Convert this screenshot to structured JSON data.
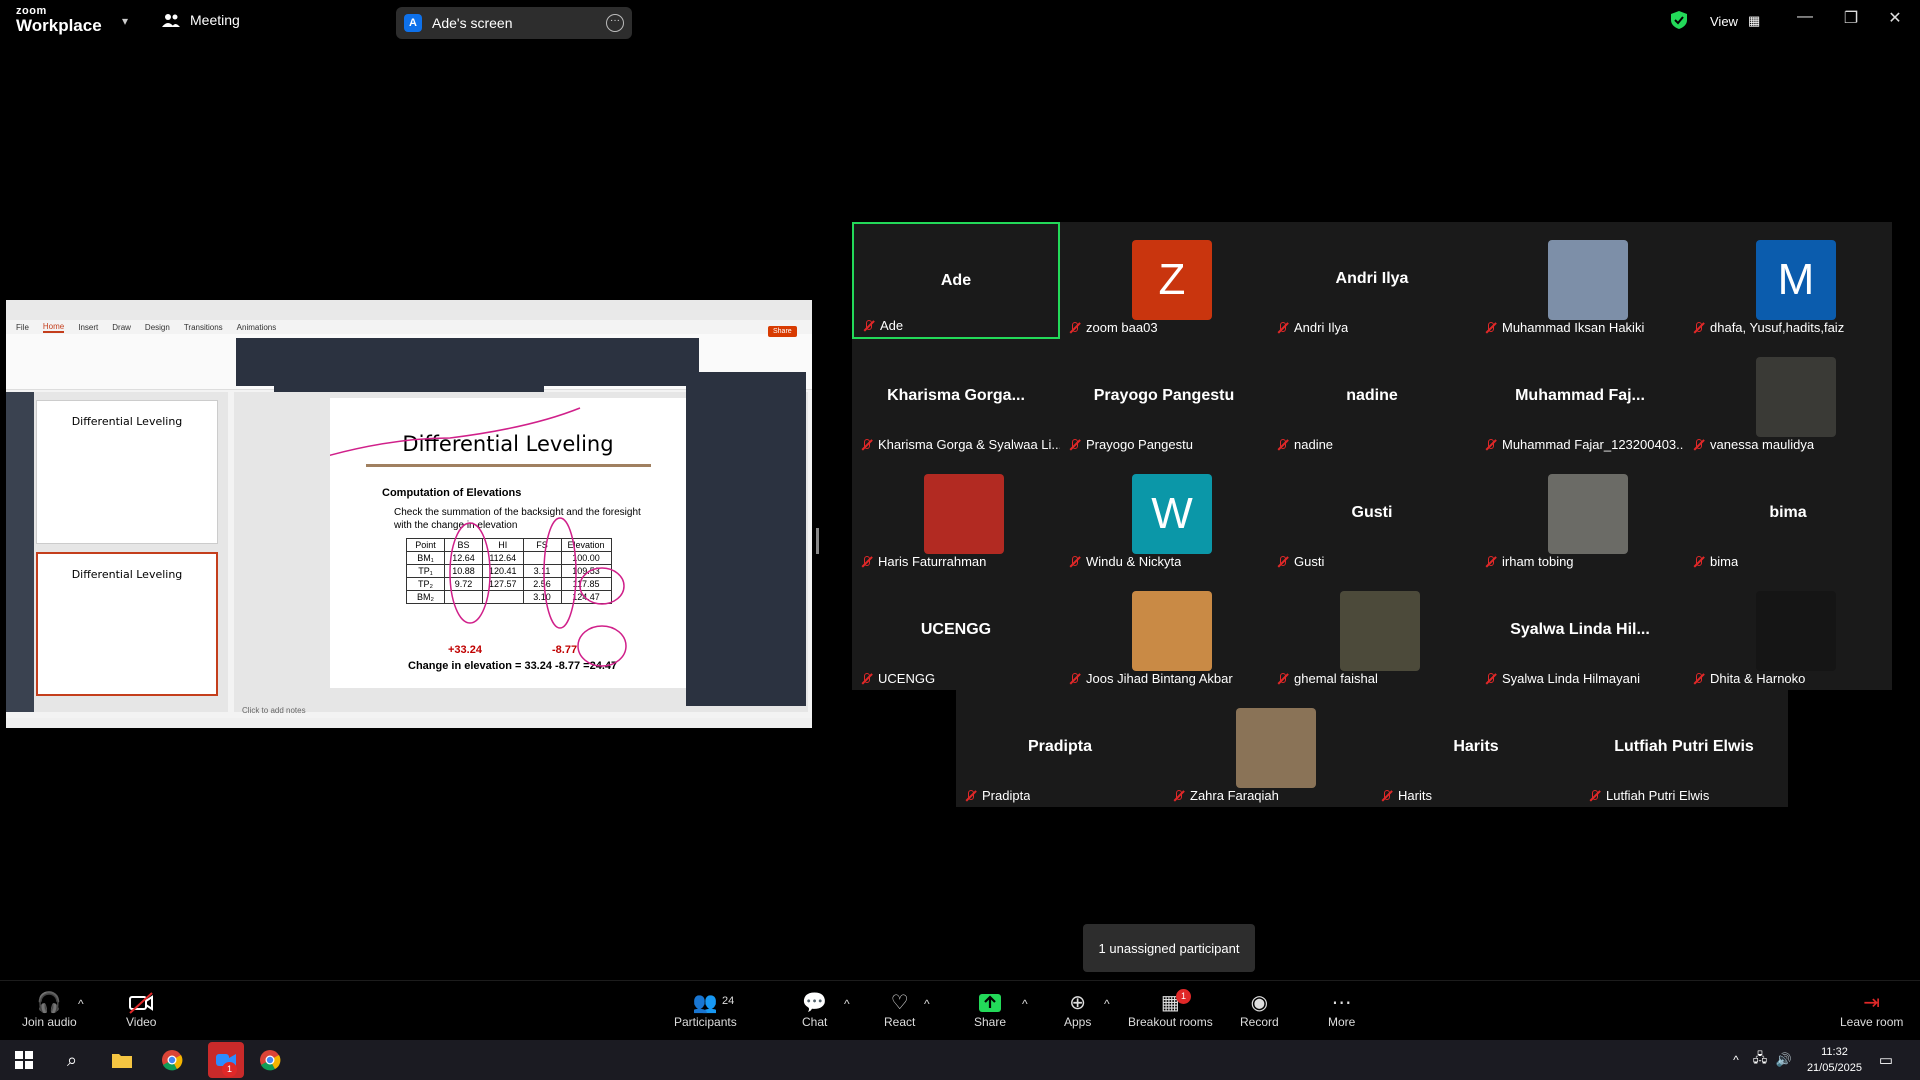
{
  "topbar": {
    "logo_line1": "zoom",
    "logo_line2": "Workplace",
    "meeting_label": "Meeting",
    "screen_badge": "A",
    "screen_label": "Ade's screen",
    "view_label": "View"
  },
  "slide": {
    "title": "Differential Leveling",
    "subtitle": "Computation of Elevations",
    "bullet": "Check the summation of the backsight and the foresight with the change in elevation",
    "headers": [
      "Point",
      "BS",
      "HI",
      "FS",
      "Elevation"
    ],
    "rows": [
      [
        "BM₁",
        "12.64",
        "112.64",
        "",
        "100.00"
      ],
      [
        "TP₁",
        "10.88",
        "120.41",
        "3.11",
        "109.53"
      ],
      [
        "TP₂",
        "9.72",
        "127.57",
        "2.56",
        "117.85"
      ],
      [
        "BM₂",
        "",
        "",
        "3.10",
        "124.47"
      ]
    ],
    "bs_sum": "+33.24",
    "fs_sum": "-8.77",
    "change": "Change in elevation = 33.24 -8.77 =24.47",
    "notes": "Click to add notes",
    "thumb_title": "Differential Leveling",
    "menu": [
      "File",
      "Home",
      "Insert",
      "Draw",
      "Design",
      "Transitions",
      "Animations"
    ],
    "share_btn": "Share"
  },
  "participants": [
    {
      "display": "Ade",
      "label": "Ade",
      "type": "name",
      "active": true
    },
    {
      "display": "Z",
      "label": "zoom baa03",
      "type": "letter",
      "color": "#c9350e"
    },
    {
      "display": "Andri Ilya",
      "label": "Andri Ilya",
      "type": "name"
    },
    {
      "display": "",
      "label": "Muhammad Iksan Hakiki",
      "type": "photo",
      "color": "#7d8fa8"
    },
    {
      "display": "M",
      "label": "dhafa, Yusuf,hadits,faiz",
      "type": "letter",
      "color": "#0b5cad"
    },
    {
      "display": "Kharisma Gorga...",
      "label": "Kharisma Gorga & Syalwaa Li...",
      "type": "name"
    },
    {
      "display": "Prayogo Pangestu",
      "label": "Prayogo Pangestu",
      "type": "name"
    },
    {
      "display": "nadine",
      "label": "nadine",
      "type": "name"
    },
    {
      "display": "Muhammad Faj...",
      "label": "Muhammad Fajar_123200403...",
      "type": "name"
    },
    {
      "display": "",
      "label": "vanessa maulidya",
      "type": "photo",
      "color": "#3a3a36"
    },
    {
      "display": "",
      "label": "Haris Faturrahman",
      "type": "photo",
      "color": "#b22a22"
    },
    {
      "display": "W",
      "label": "Windu & Nickyta",
      "type": "letter",
      "color": "#0b97a8"
    },
    {
      "display": "Gusti",
      "label": "Gusti",
      "type": "name"
    },
    {
      "display": "",
      "label": "irham tobing",
      "type": "photo",
      "color": "#6b6b66"
    },
    {
      "display": "bima",
      "label": "bima",
      "type": "name"
    },
    {
      "display": "UCENGG",
      "label": "UCENGG",
      "type": "name"
    },
    {
      "display": "",
      "label": "Joos Jihad Bintang Akbar",
      "type": "photo",
      "color": "#c98a45"
    },
    {
      "display": "",
      "label": "ghemal faishal",
      "type": "photo",
      "color": "#4c4a3a"
    },
    {
      "display": "Syalwa Linda Hil...",
      "label": "Syalwa Linda Hilmayani",
      "type": "name"
    },
    {
      "display": "",
      "label": "Dhita & Harnoko",
      "type": "photo",
      "color": "#151515"
    },
    {
      "display": "Pradipta",
      "label": "Pradipta",
      "type": "name"
    },
    {
      "display": "",
      "label": "Zahra Faraqiah",
      "type": "photo",
      "color": "#8a7357"
    },
    {
      "display": "Harits",
      "label": "Harits",
      "type": "name"
    },
    {
      "display": "Lutfiah Putri Elwis",
      "label": "Lutfiah Putri Elwis",
      "type": "name"
    }
  ],
  "tooltip": "1 unassigned participant",
  "toolbar": {
    "join_audio": "Join audio",
    "video": "Video",
    "participants": "Participants",
    "participants_count": "24",
    "chat": "Chat",
    "react": "React",
    "share": "Share",
    "apps": "Apps",
    "breakout": "Breakout rooms",
    "breakout_badge": "1",
    "record": "Record",
    "more": "More",
    "leave": "Leave room"
  },
  "taskbar": {
    "time": "11:32",
    "date": "21/05/2025",
    "zoom_badge": "1"
  },
  "colors": {
    "accent_green": "#23d959",
    "brand_blue": "#0e71eb",
    "mute_red": "#e02828"
  }
}
